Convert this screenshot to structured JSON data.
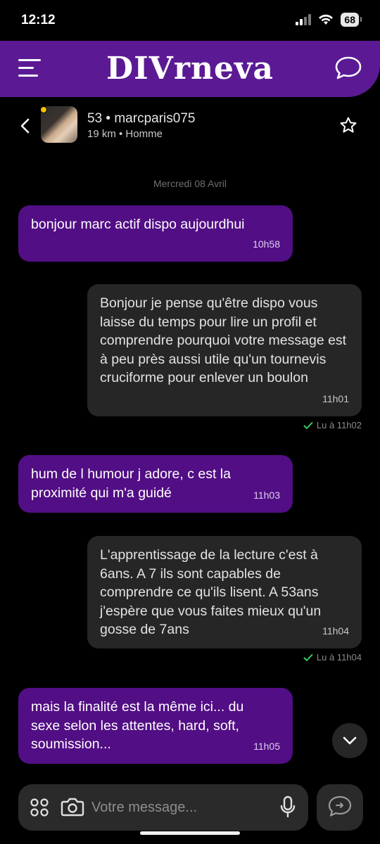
{
  "status": {
    "time": "12:12",
    "battery": "68"
  },
  "header": {
    "brand": "DIVrneva"
  },
  "conversation": {
    "title": "53 • marcparis075",
    "subtitle": "19 km • Homme"
  },
  "day_label": "Mercredi 08 Avril",
  "messages": [
    {
      "dir": "in",
      "text": "bonjour marc actif dispo aujourdhui",
      "time": "10h58"
    },
    {
      "dir": "out",
      "text": "Bonjour je pense qu'être dispo vous laisse du temps pour lire un profil et comprendre pourquoi votre message est à peu près aussi utile qu'un tournevis cruciforme pour enlever un boulon",
      "time": "11h01",
      "read": "Lu à 11h02"
    },
    {
      "dir": "in",
      "text": "hum de l humour j adore, c est la proximité qui m'a guidé",
      "time": "11h03"
    },
    {
      "dir": "out",
      "text": "L'apprentissage de la lecture c'est à 6ans. A 7 ils sont capables de comprendre ce qu'ils lisent. A 53ans j'espère que vous faites mieux qu'un gosse de 7ans",
      "time": "11h04",
      "read": "Lu à 11h04"
    },
    {
      "dir": "in",
      "text": "mais la finalité est la même ici... du sexe selon les attentes, hard, soft, soumission...",
      "time": "11h05"
    }
  ],
  "composer": {
    "placeholder": "Votre message..."
  },
  "colors": {
    "brand": "#5b1a94",
    "incoming_bubble": "#520e84",
    "outgoing_bubble": "#262626",
    "read_check": "#3ec95a",
    "online_dot": "#f2c200"
  },
  "icons": [
    "menu-icon",
    "chat-bubble-icon",
    "chevron-left-icon",
    "star-icon",
    "check-icon",
    "chevron-down-icon",
    "grid-icon",
    "camera-icon",
    "microphone-icon",
    "send-chat-icon"
  ]
}
